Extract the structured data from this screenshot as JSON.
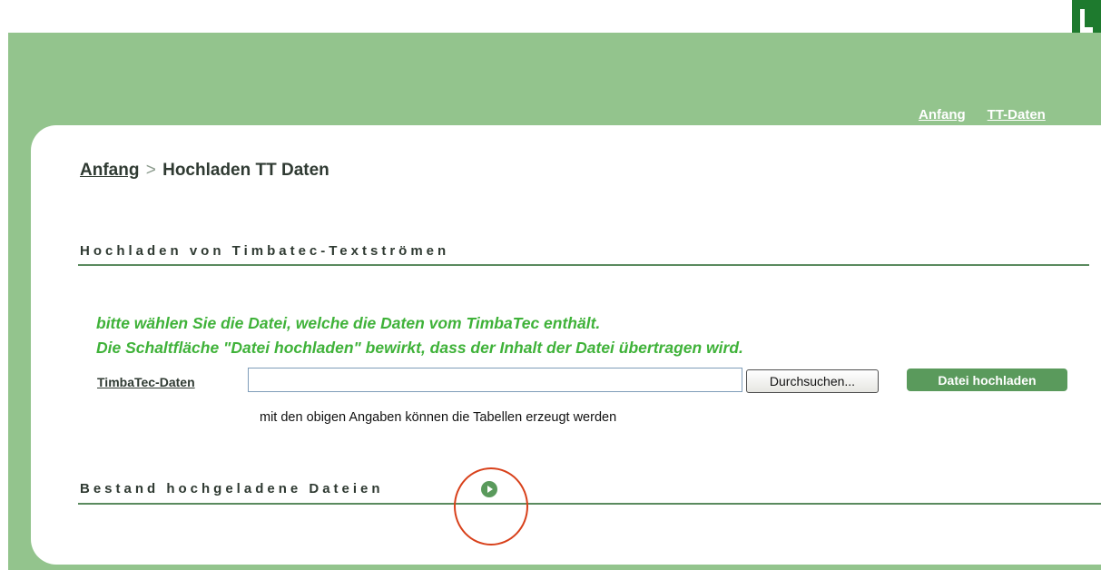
{
  "header": {
    "nav": [
      {
        "label": "Anfang"
      },
      {
        "label": "TT-Daten"
      }
    ]
  },
  "breadcrumb": {
    "home": "Anfang",
    "separator": ">",
    "current": "Hochladen TT Daten"
  },
  "sections": {
    "upload_title": "Hochladen von Timbatec-Textströmen",
    "inventory_title": "Bestand hochgeladene Dateien"
  },
  "upload": {
    "hint_line1": "bitte wählen Sie die Datei, welche die Daten vom TimbaTec enthält.",
    "hint_line2": "Die Schaltfläche \"Datei hochladen\" bewirkt, dass der Inhalt der Datei übertragen wird.",
    "field_label": "TimbaTec-Daten",
    "file_value": "",
    "browse_label": "Durchsuchen...",
    "upload_label": "Datei hochladen",
    "note": "mit den obigen Angaben können die Tabellen erzeugt werden"
  },
  "colors": {
    "brand_green": "#93c48d",
    "hint_green": "#3fb239",
    "button_green": "#5a9a5c",
    "annotation_red": "#d8401a"
  }
}
